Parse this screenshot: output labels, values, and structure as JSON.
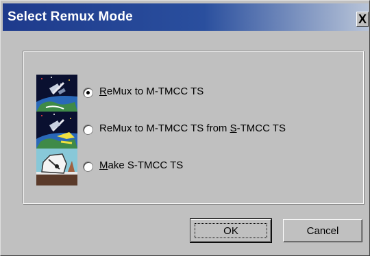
{
  "window": {
    "title": "Select Remux Mode",
    "close_glyph": "X"
  },
  "options": [
    {
      "icon": "satellite-earth-icon",
      "mnemonic": "R",
      "rest": "eMux to M-TMCC TS",
      "selected": true
    },
    {
      "icon": "satellite-relay-icon",
      "prefix": "ReMux to M-TMCC TS from ",
      "mnemonic": "S",
      "rest": "-TMCC TS",
      "selected": false
    },
    {
      "icon": "dish-antenna-icon",
      "mnemonic": "M",
      "rest": "ake S-TMCC TS",
      "selected": false
    }
  ],
  "buttons": {
    "ok": "OK",
    "cancel": "Cancel"
  },
  "colors": {
    "titlebar": "#1e3a8c",
    "face": "#c0c0c0"
  }
}
